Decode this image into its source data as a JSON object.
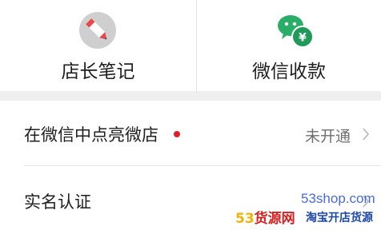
{
  "tiles": [
    {
      "label": "店长笔记",
      "icon": "notebook-pencil-icon"
    },
    {
      "label": "微信收款",
      "icon": "wechat-payment-icon"
    }
  ],
  "rows": [
    {
      "label": "在微信中点亮微店",
      "has_badge": true,
      "value": "未开通",
      "chevron": "chevron-right-icon"
    },
    {
      "label": "实名认证",
      "value": "",
      "chevron": "chevron-right-icon"
    }
  ],
  "watermark": {
    "url": "53shop.com",
    "brand_number": "53",
    "brand_name": "货源网",
    "slogan": "淘宝开店货源"
  },
  "colors": {
    "badge_red": "#e0202a",
    "wechat_green": "#2aae67",
    "watermark_red": "#d81e1e"
  }
}
